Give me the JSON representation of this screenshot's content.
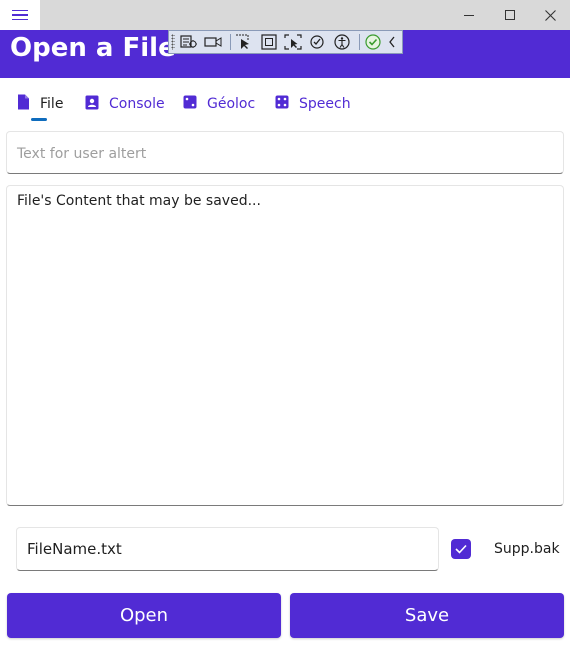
{
  "window": {
    "menu_icon": "hamburger-icon",
    "controls": [
      "minimize-icon",
      "maximize-icon",
      "close-icon"
    ]
  },
  "header": {
    "title": "Open a File",
    "background_color": "#512bd4"
  },
  "debug_toolbar": {
    "icons": [
      "live-visual-tree-icon",
      "video-icon",
      "select-element-icon",
      "display-layout-adorners-icon",
      "track-focus-icon",
      "binding-failures-icon",
      "accessibility-icon",
      "checked-icon",
      "collapse-chevron-icon"
    ]
  },
  "tabs": [
    {
      "label": "File",
      "icon": "file-icon",
      "active": true
    },
    {
      "label": "Console",
      "icon": "contact-icon",
      "active": false
    },
    {
      "label": "Géoloc",
      "icon": "dice-icon",
      "active": false
    },
    {
      "label": "Speech",
      "icon": "dice-four-icon",
      "active": false
    }
  ],
  "alert_entry": {
    "placeholder": "Text for user altert",
    "value": ""
  },
  "editor": {
    "value": "File's Content that may be saved..."
  },
  "filename": {
    "value": "FileName.txt"
  },
  "supp_bak": {
    "label": "Supp.bak",
    "checked": true
  },
  "buttons": {
    "open": "Open",
    "save": "Save"
  },
  "colors": {
    "accent": "#512bd4",
    "tab_underline": "#0f6cbd"
  }
}
